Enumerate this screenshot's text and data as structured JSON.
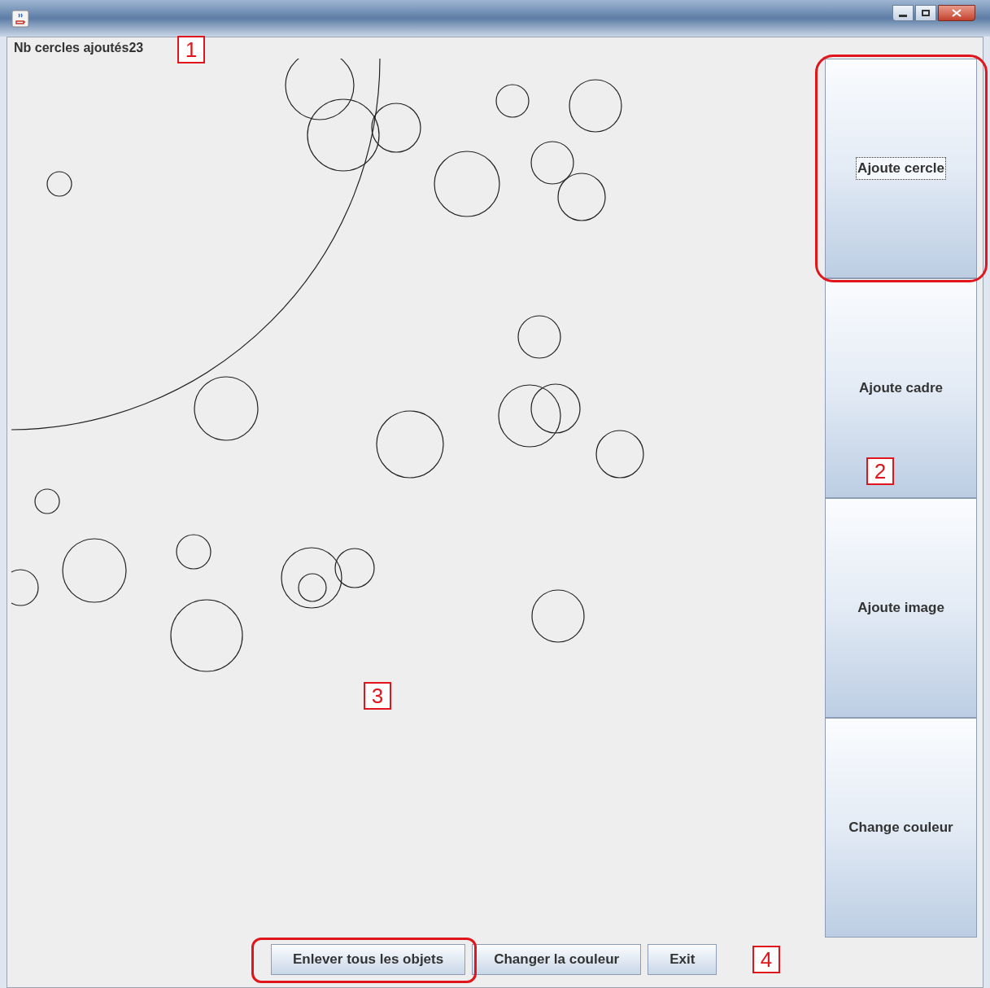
{
  "counter_label": "Nb cercles ajoutés23",
  "side_buttons": [
    {
      "label": "Ajoute cercle",
      "focused": true
    },
    {
      "label": "Ajoute cadre",
      "focused": false
    },
    {
      "label": "Ajoute image",
      "focused": false
    },
    {
      "label": "Change couleur",
      "focused": false
    }
  ],
  "bottom_buttons": [
    {
      "label": "Enlever tous les objets"
    },
    {
      "label": "Changer la couleur"
    },
    {
      "label": "Exit"
    }
  ],
  "annotations": [
    {
      "label": "1"
    },
    {
      "label": "2"
    },
    {
      "label": "3"
    },
    {
      "label": "4"
    }
  ]
}
